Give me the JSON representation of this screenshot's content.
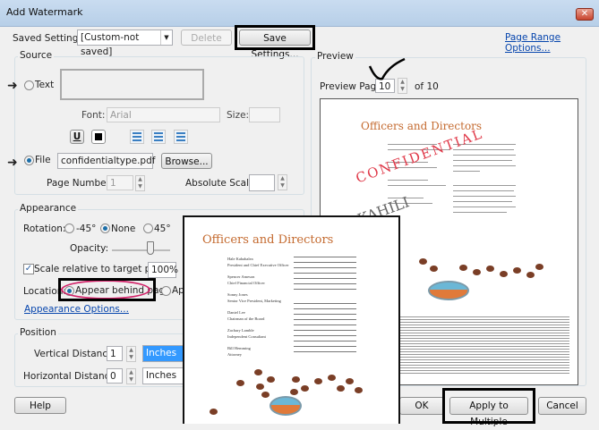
{
  "window": {
    "title": "Add Watermark",
    "close_glyph": "✕"
  },
  "top": {
    "saved_settings_label": "Saved Settings:",
    "saved_settings_value": "[Custom-not saved]",
    "delete": "Delete",
    "save_settings": "Save Settings...",
    "page_range": "Page Range Options..."
  },
  "source": {
    "title": "Source",
    "text_label": "Text",
    "font_label": "Font:",
    "font_value": "Arial",
    "size_label": "Size:",
    "underline": "U",
    "file_label": "File",
    "file_value": "confidentialtype.pdf",
    "browse": "Browse...",
    "page_number_label": "Page Number:",
    "page_number_value": "1",
    "abs_scale_label": "Absolute Scale:"
  },
  "appearance": {
    "title": "Appearance",
    "rotation_label": "Rotation:",
    "rot_neg45": "-45°",
    "rot_none": "None",
    "rot_45": "45°",
    "opacity_label": "Opacity:",
    "scale_label": "Scale relative to target page",
    "scale_value": "100%",
    "location_label": "Location:",
    "behind": "Appear behind page",
    "on_top_partial": "Ap",
    "options_link": "Appearance Options..."
  },
  "position": {
    "title": "Position",
    "vertical_label": "Vertical Distance:",
    "vertical_value": "1",
    "vertical_unit": "Inches",
    "horizontal_label": "Horizontal Distance:",
    "horizontal_value": "0",
    "horizontal_unit": "Inches"
  },
  "preview": {
    "title": "Preview",
    "page_label": "Preview Page",
    "page_value": "10",
    "of_label": "of 10",
    "watermark": "CONFIDENTIAL",
    "logo": "KAHILI"
  },
  "doc": {
    "heading": "Officers and Directors",
    "officers": [
      [
        "Hale Kahahalea",
        "President and Chief Executive Officer"
      ],
      [
        "Spencer Ameson",
        "Chief Financial Officer"
      ],
      [
        "Sonny Jones",
        "Senior Vice President, Marketing"
      ],
      [
        "Daniel Lee",
        "Chairman of the Board"
      ],
      [
        "Zachary Lamble",
        "Independent Consultant"
      ],
      [
        "Bill Hemming",
        "Attorney"
      ]
    ]
  },
  "buttons": {
    "help": "Help",
    "ok": "OK",
    "apply_multiple": "Apply to Multiple",
    "cancel": "Cancel"
  }
}
